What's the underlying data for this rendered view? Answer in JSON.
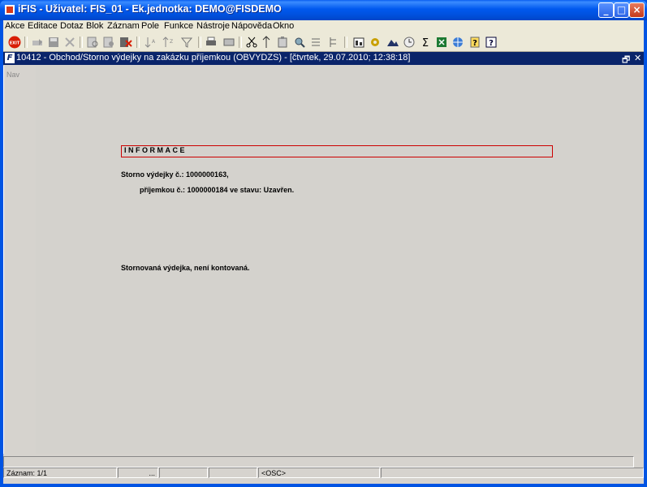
{
  "window": {
    "title": "iFIS - Uživatel: FIS_01 - Ek.jednotka: DEMO@FISDEMO",
    "controls": [
      "_",
      "□",
      "×"
    ]
  },
  "menu": [
    "Akce",
    "Editace",
    "Dotaz",
    "Blok",
    "Záznam",
    "Pole",
    "Funkce",
    "Nástroje",
    "Nápověda",
    "Okno"
  ],
  "toolbar": {
    "exit_label": "EXIT",
    "sigma": "Σ",
    "help": "?"
  },
  "document": {
    "icon_letter": "F",
    "title": "10412 - Obchod/Storno výdejky na zakázku příjemkou (OBVYDZS) - [čtvrtek, 29.07.2010; 12:38:18]",
    "restore": "🗗",
    "close": "✕"
  },
  "nav": {
    "label": "Nav"
  },
  "info": {
    "heading": "INFORMACE",
    "line1": "Storno výdejky č.: 1000000163,",
    "line2": "příjemkou č.: 1000000184 ve stavu: Uzavřen.",
    "line3": "Stornovaná výdejka, není kontovaná."
  },
  "status": {
    "record": "Záznam: 1/1",
    "dots": "...",
    "osc": "<OSC>"
  },
  "colors": {
    "titlebar": "#0054e3",
    "doc_titlebar": "#0a246a",
    "info_border": "#cc0000",
    "background": "#d4d2cd"
  }
}
